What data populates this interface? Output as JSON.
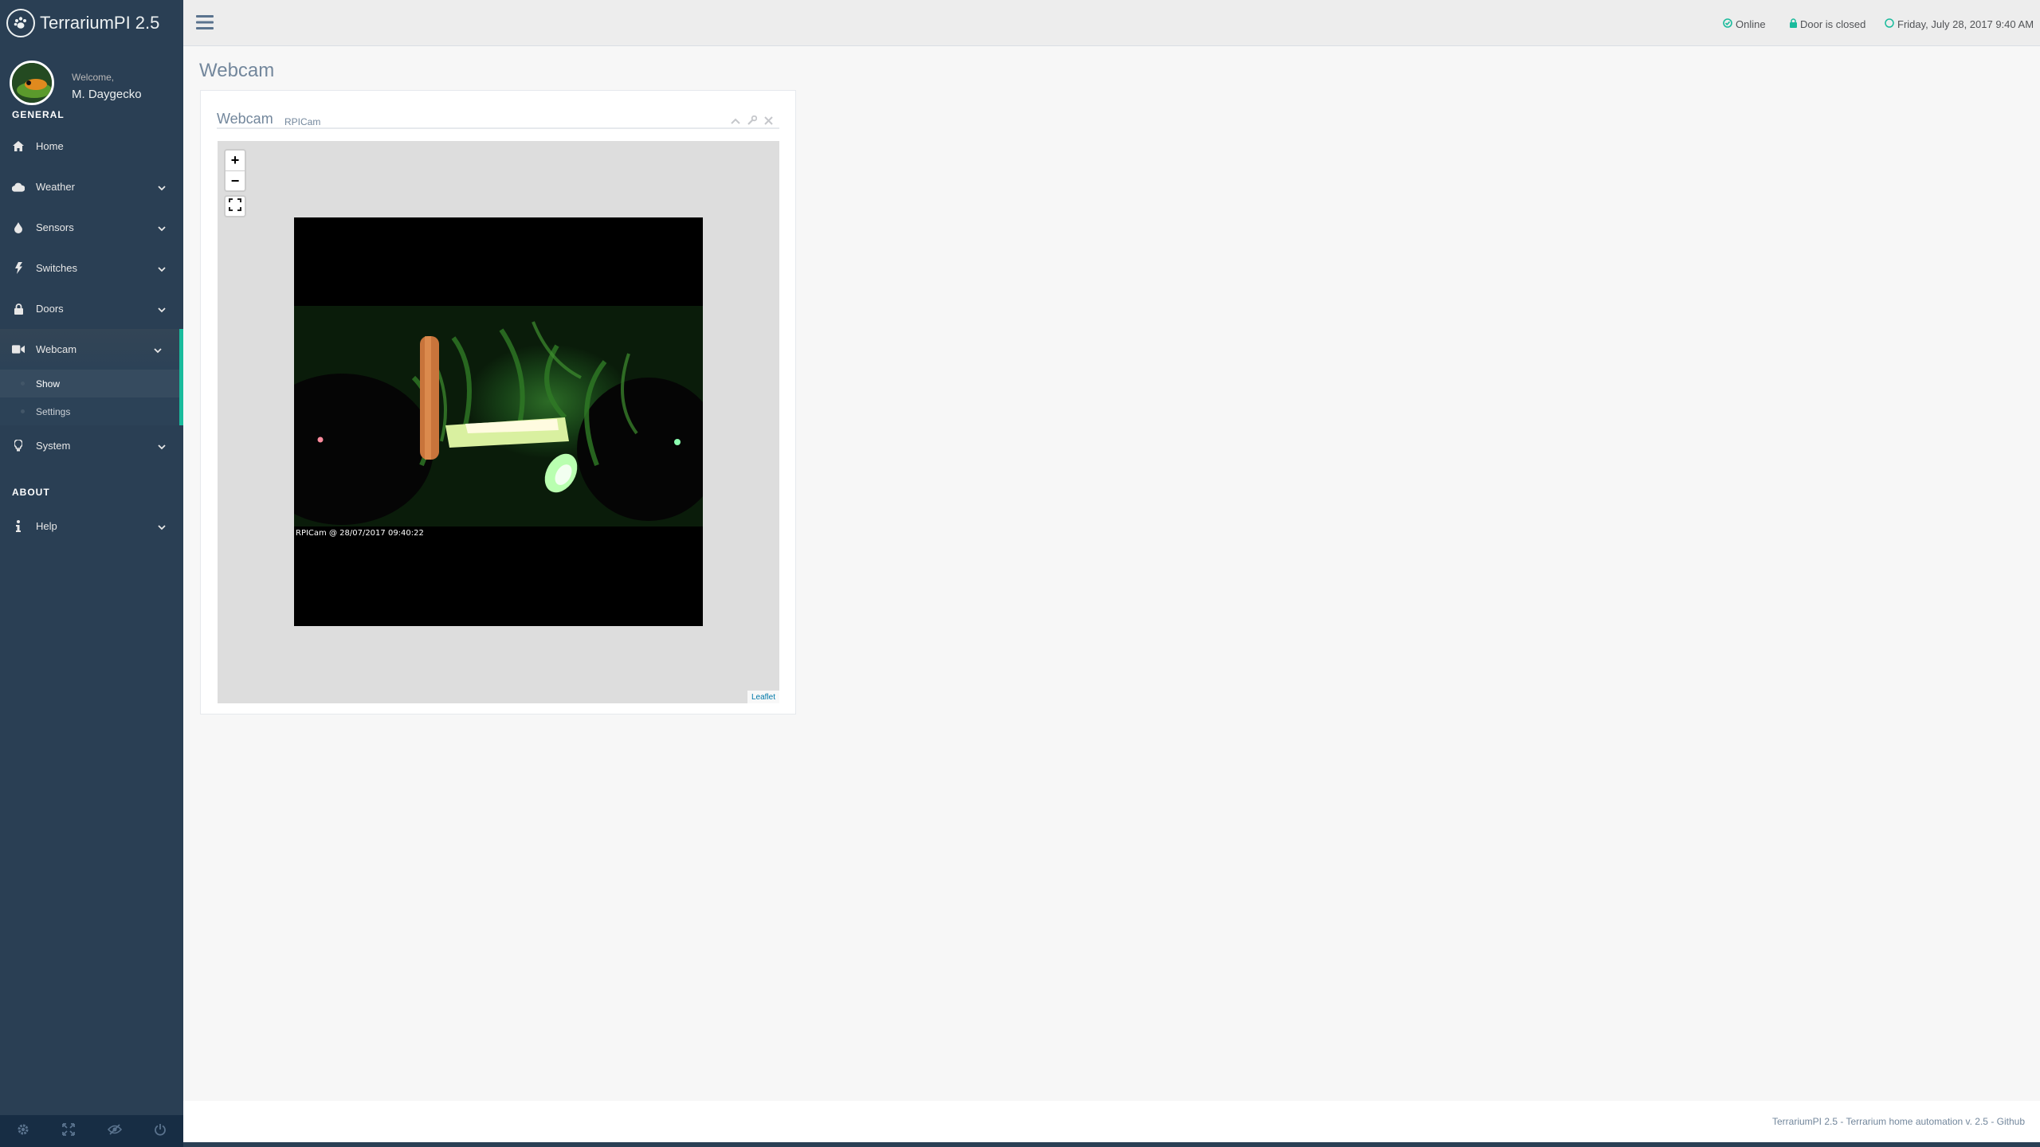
{
  "app": {
    "title": "TerrariumPI 2.5"
  },
  "profile": {
    "welcome": "Welcome,",
    "name": "M. Daygecko"
  },
  "sidebar": {
    "section_general": "GENERAL",
    "section_about": "ABOUT",
    "items": [
      {
        "label": "Home",
        "icon": "home-icon"
      },
      {
        "label": "Weather",
        "icon": "cloud-icon"
      },
      {
        "label": "Sensors",
        "icon": "tint-icon"
      },
      {
        "label": "Switches",
        "icon": "bolt-icon"
      },
      {
        "label": "Doors",
        "icon": "lock-icon"
      },
      {
        "label": "Webcam",
        "icon": "video-camera-icon",
        "active": true
      },
      {
        "label": "System",
        "icon": "lightbulb-icon"
      },
      {
        "label": "Help",
        "icon": "info-icon"
      }
    ],
    "webcam_submenu": [
      {
        "label": "Show",
        "current": true
      },
      {
        "label": "Settings"
      }
    ],
    "footer_buttons": [
      "settings-icon",
      "fullscreen-icon",
      "eye-slash-icon",
      "power-icon"
    ]
  },
  "topbar": {
    "online": "Online",
    "door": "Door is closed",
    "datetime": "Friday, July 28, 2017 9:40 AM"
  },
  "page": {
    "title": "Webcam"
  },
  "panel": {
    "title": "Webcam",
    "subtitle": "RPICam",
    "map": {
      "zoom_in": "+",
      "zoom_out": "−",
      "caption": "RPICam @ 28/07/2017 09:40:22",
      "attribution": "Leaflet"
    }
  },
  "footer": {
    "text": "TerrariumPI 2.5 - Terrarium home automation v. 2.5 - Github"
  },
  "colors": {
    "sidebar": "#2a3f54",
    "accent": "#1abb9c",
    "background": "#f7f7f7"
  }
}
